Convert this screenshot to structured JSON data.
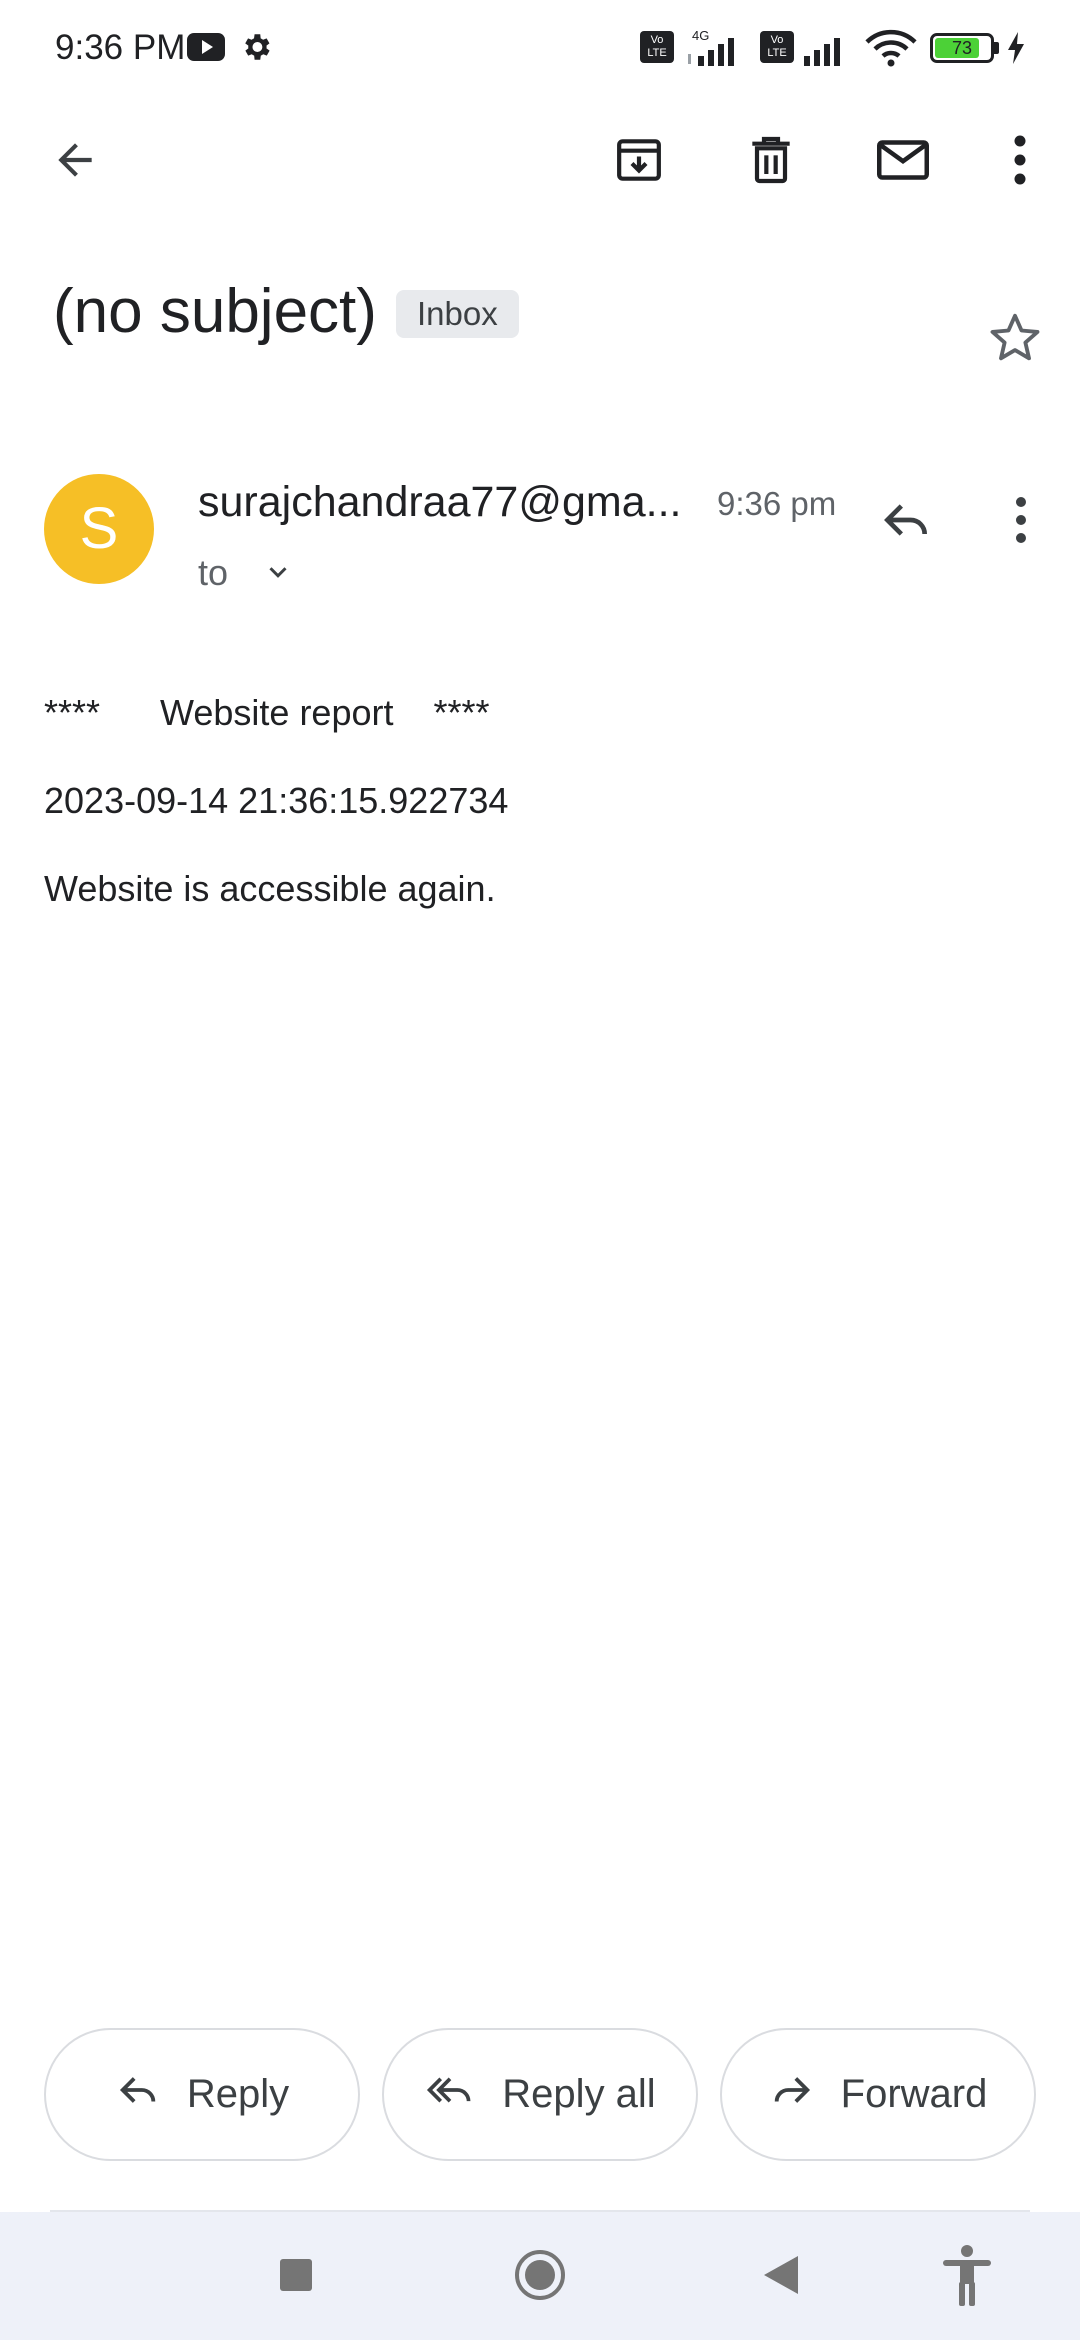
{
  "status_bar": {
    "time": "9:36 PM",
    "battery_level": "73",
    "network_type": "4G",
    "volte_label_top": "Vo",
    "volte_label_bottom": "LTE",
    "icons": [
      "youtube-icon",
      "settings-gear-icon",
      "volte-icon",
      "signal-icon",
      "wifi-icon",
      "battery-icon",
      "charging-bolt-icon"
    ]
  },
  "toolbar": {
    "icons": [
      "back-arrow-icon",
      "archive-icon",
      "delete-icon",
      "mark-unread-icon",
      "more-vert-icon"
    ]
  },
  "email": {
    "subject": "(no subject)",
    "label": "Inbox",
    "sender": {
      "avatar_letter": "S",
      "avatar_color": "#f6bf26",
      "name": "surajchandraa77@gma...",
      "time": "9:36 pm",
      "to": "to"
    },
    "body": [
      "****      Website report    ****",
      "2023-09-14 21:36:15.922734",
      "Website is accessible again."
    ]
  },
  "actions": {
    "reply": "Reply",
    "reply_all": "Reply all",
    "forward": "Forward"
  },
  "nav_bar": {
    "icons": [
      "recents-square-icon",
      "home-circle-icon",
      "back-triangle-icon",
      "accessibility-icon"
    ]
  },
  "colors": {
    "accent_avatar": "#f6bf26",
    "battery_fill": "#4cd137",
    "chip_bg": "#e8eaed",
    "nav_bg": "#eef1f9"
  }
}
